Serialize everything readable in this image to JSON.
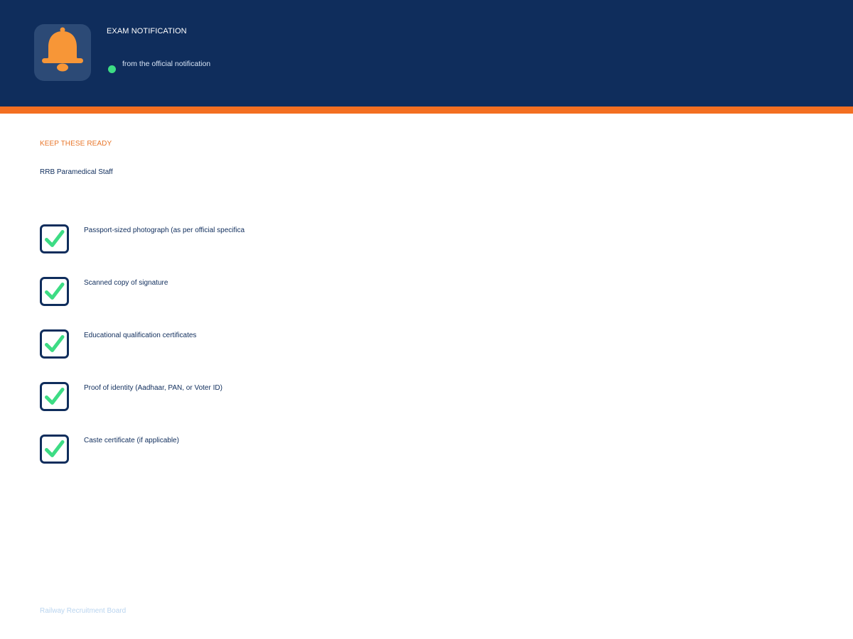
{
  "header": {
    "title": "EXAM NOTIFICATION",
    "subtitle": "from the official notification",
    "icon": "bell-icon",
    "status_color": "#3ddc84"
  },
  "colors": {
    "header_bg": "#0f2d5c",
    "accent": "#f36f21",
    "check": "#3ddc84"
  },
  "section": {
    "label": "KEEP THESE READY",
    "exam_name": "RRB Paramedical Staff"
  },
  "checklist": {
    "items": [
      {
        "label": "Passport-sized photograph (as per official specifica",
        "icon": "checkbox-checked-icon"
      },
      {
        "label": "Scanned copy of signature",
        "icon": "checkbox-checked-icon"
      },
      {
        "label": "Educational qualification certificates",
        "icon": "checkbox-checked-icon"
      },
      {
        "label": "Proof of identity (Aadhaar, PAN, or Voter ID)",
        "icon": "checkbox-checked-icon"
      },
      {
        "label": "Caste certificate (if applicable)",
        "icon": "checkbox-checked-icon"
      }
    ]
  },
  "footer": {
    "text": "Railway Recruitment Board"
  }
}
